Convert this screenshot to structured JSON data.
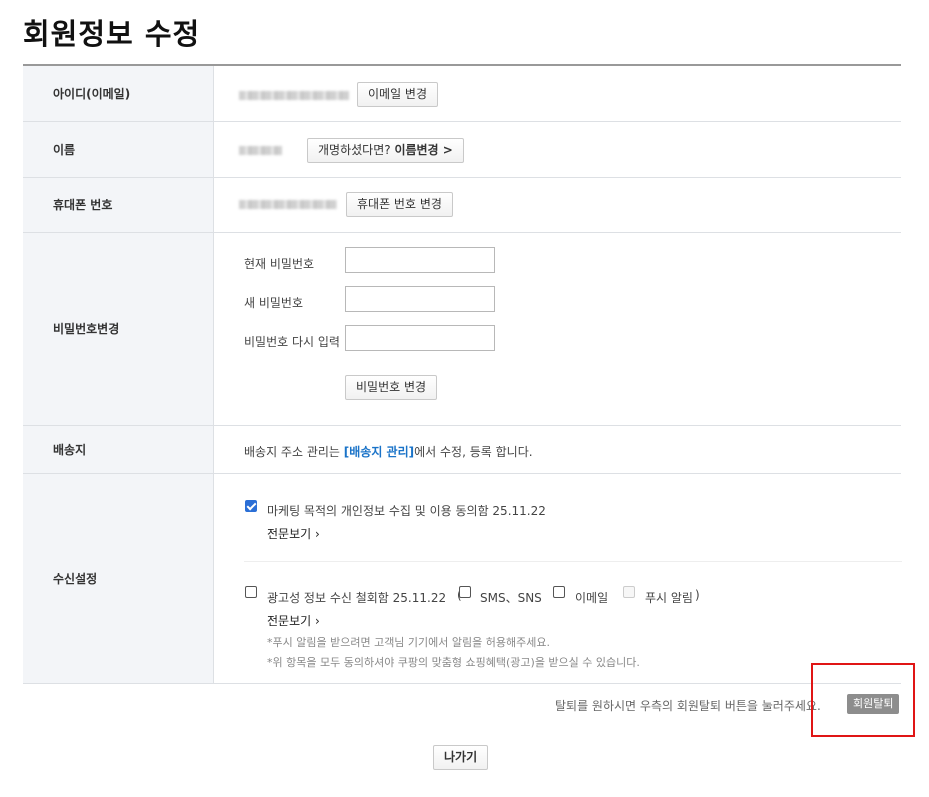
{
  "page": {
    "title": "회원정보 수정"
  },
  "rows": {
    "email": {
      "label": "아이디(이메일)",
      "button": "이메일 변경"
    },
    "name": {
      "label": "이름",
      "button_prefix": "개명하셨다면? ",
      "button_strong": "이름변경 >"
    },
    "phone": {
      "label": "휴대폰 번호",
      "button": "휴대폰 번호 변경"
    },
    "password": {
      "label": "비밀번호변경",
      "current_label": "현재 비밀번호",
      "new_label": "새 비밀번호",
      "confirm_label": "비밀번호 다시 입력",
      "button": "비밀번호 변경"
    },
    "shipping": {
      "label": "배송지",
      "text_before": "배송지 주소 관리는 ",
      "link": "[배송지 관리]",
      "text_after": "에서 수정, 등록 합니다."
    },
    "subscription": {
      "label": "수신설정",
      "marketing_label": "마케팅 목적의 개인정보 수집 및 이용 동의함 25.11.22",
      "marketing_checked": true,
      "view_full_1": "전문보기 ›",
      "ads_label": "광고성 정보 수신 철회함 25.11.22",
      "paren_open": "(",
      "sms_label": "SMS、SNS",
      "email_label": "이메일",
      "push_label": "푸시 알림",
      "paren_close": ")",
      "view_full_2": "전문보기 ›",
      "note1": "*푸시 알림을 받으려면 고객님 기기에서 알림을 허용해주세요.",
      "note2": "*위 항목을 모두 동의하셔야 쿠팡의 맞춤형 쇼핑혜택(광고)을 받으실 수 있습니다."
    }
  },
  "withdraw": {
    "text": "탈퇴를 원하시면 우측의 회원탈퇴 버튼을 눌러주세요.",
    "button": "회원탈퇴"
  },
  "exit_button": "나가기",
  "colors": {
    "accent_link": "#1a73c8",
    "checkbox": "#2b6fd6",
    "highlight": "#e01515"
  }
}
